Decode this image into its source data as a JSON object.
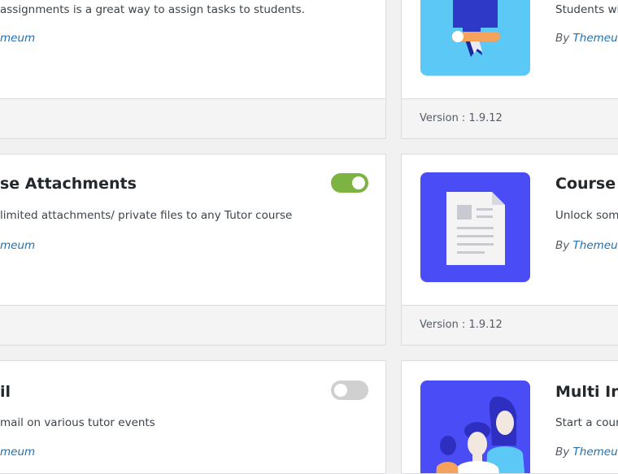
{
  "cards_left": [
    {
      "description": "assignments is a great way to assign tasks to students.",
      "author_prefix": "",
      "author_link": "meum"
    },
    {
      "title": "se Attachments",
      "description": "limited attachments/ private files to any Tutor course",
      "author_prefix": "",
      "author_link": "meum",
      "enabled": true
    },
    {
      "title": "il",
      "description": "mail on various tutor events",
      "author_prefix": "",
      "author_link": "meum",
      "enabled": false
    }
  ],
  "cards_right": [
    {
      "description": "Students wil",
      "author_prefix": "By ",
      "author_link": "Themeum",
      "version": "Version : 1.9.12"
    },
    {
      "title": "Course P",
      "description": "Unlock some",
      "author_prefix": "By ",
      "author_link": "Themeum",
      "version": "Version : 1.9.12"
    },
    {
      "title": "Multi Ins",
      "description": "Start a cours",
      "author_prefix": "By ",
      "author_link": "Themeum"
    }
  ],
  "colors": {
    "toggle_on": "#7cb342",
    "toggle_off": "#d0d0d0",
    "link": "#2271b1",
    "thumb_assignments_bg": "#5bc8f5",
    "thumb_blue_bg": "#4a4cf5"
  },
  "icons": {
    "assignments": "certificate-ribbon-icon",
    "course_preview": "document-icon",
    "multi_instructor": "people-group-icon"
  }
}
